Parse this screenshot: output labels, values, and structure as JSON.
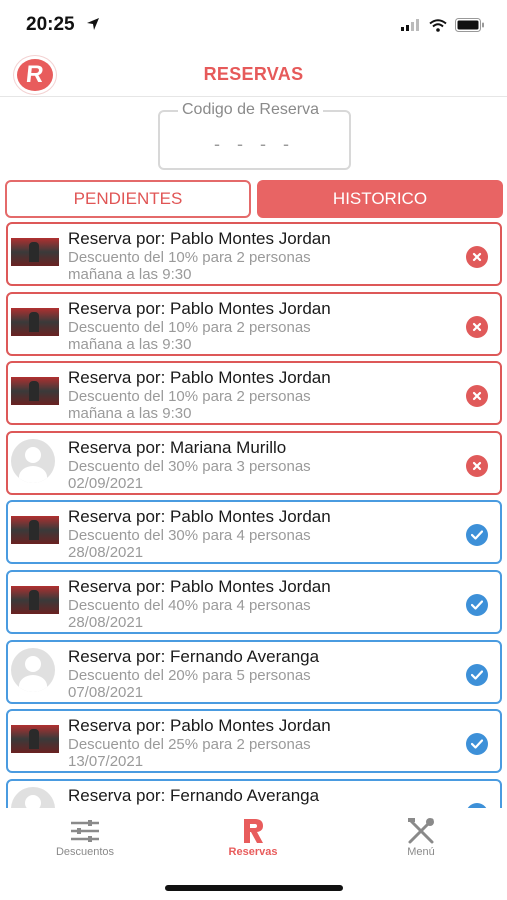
{
  "status_bar": {
    "time": "20:25"
  },
  "header": {
    "title": "RESERVAS",
    "logo_letter": "R"
  },
  "code": {
    "label": "Codigo de Reserva",
    "placeholder": "- - - -"
  },
  "tabs": [
    {
      "label": "PENDIENTES",
      "active": false
    },
    {
      "label": "HISTORICO",
      "active": true
    }
  ],
  "reservations": [
    {
      "title": "Reserva por: Pablo Montes Jordan",
      "desc": "Descuento del 10% para 2 personas",
      "date": "mañana a las 9:30",
      "status": "cancelled",
      "avatar": "photo"
    },
    {
      "title": "Reserva por: Pablo Montes Jordan",
      "desc": "Descuento del 10% para 2 personas",
      "date": "mañana a las 9:30",
      "status": "cancelled",
      "avatar": "photo"
    },
    {
      "title": "Reserva por: Pablo Montes Jordan",
      "desc": "Descuento del 10% para 2 personas",
      "date": "mañana a las 9:30",
      "status": "cancelled",
      "avatar": "photo"
    },
    {
      "title": "Reserva por: Mariana Murillo",
      "desc": "Descuento del 30% para 3 personas",
      "date": "02/09/2021",
      "status": "cancelled",
      "avatar": "generic"
    },
    {
      "title": "Reserva por: Pablo Montes Jordan",
      "desc": "Descuento del 30% para 4 personas",
      "date": "28/08/2021",
      "status": "completed",
      "avatar": "photo"
    },
    {
      "title": "Reserva por: Pablo Montes Jordan",
      "desc": "Descuento del 40% para 4 personas",
      "date": "28/08/2021",
      "status": "completed",
      "avatar": "photo"
    },
    {
      "title": "Reserva por: Fernando Averanga",
      "desc": "Descuento del 20% para 5 personas",
      "date": "07/08/2021",
      "status": "completed",
      "avatar": "generic"
    },
    {
      "title": "Reserva por: Pablo Montes Jordan",
      "desc": "Descuento del 25% para 2 personas",
      "date": "13/07/2021",
      "status": "completed",
      "avatar": "photo"
    },
    {
      "title": "Reserva por: Fernando Averanga",
      "desc": "",
      "date": "",
      "status": "completed",
      "avatar": "generic"
    }
  ],
  "tabbar": {
    "items": [
      {
        "label": "Descuentos",
        "icon": "sliders-icon"
      },
      {
        "label": "Reservas",
        "icon": "logo-r-icon",
        "active": true
      },
      {
        "label": "Menú",
        "icon": "utensils-icon"
      }
    ]
  },
  "colors": {
    "accent": "#e85c5c",
    "completed": "#3d90d8",
    "muted": "#9a9a9a"
  }
}
